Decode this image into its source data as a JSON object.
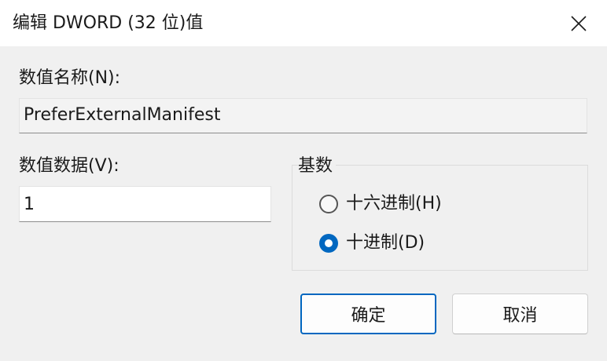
{
  "window": {
    "title": "编辑 DWORD (32 位)值"
  },
  "name_section": {
    "label": "数值名称(N):",
    "value": "PreferExternalManifest"
  },
  "data_section": {
    "label": "数值数据(V):",
    "value": "1"
  },
  "base_section": {
    "label": "基数",
    "options": [
      {
        "label": "十六进制(H)",
        "checked": false
      },
      {
        "label": "十进制(D)",
        "checked": true
      }
    ]
  },
  "buttons": {
    "ok_label": "确定",
    "cancel_label": "取消"
  },
  "icons": {
    "close": "close-icon"
  },
  "colors": {
    "accent": "#0067c0",
    "background": "#f0f0f0",
    "titlebar": "#ffffff"
  }
}
